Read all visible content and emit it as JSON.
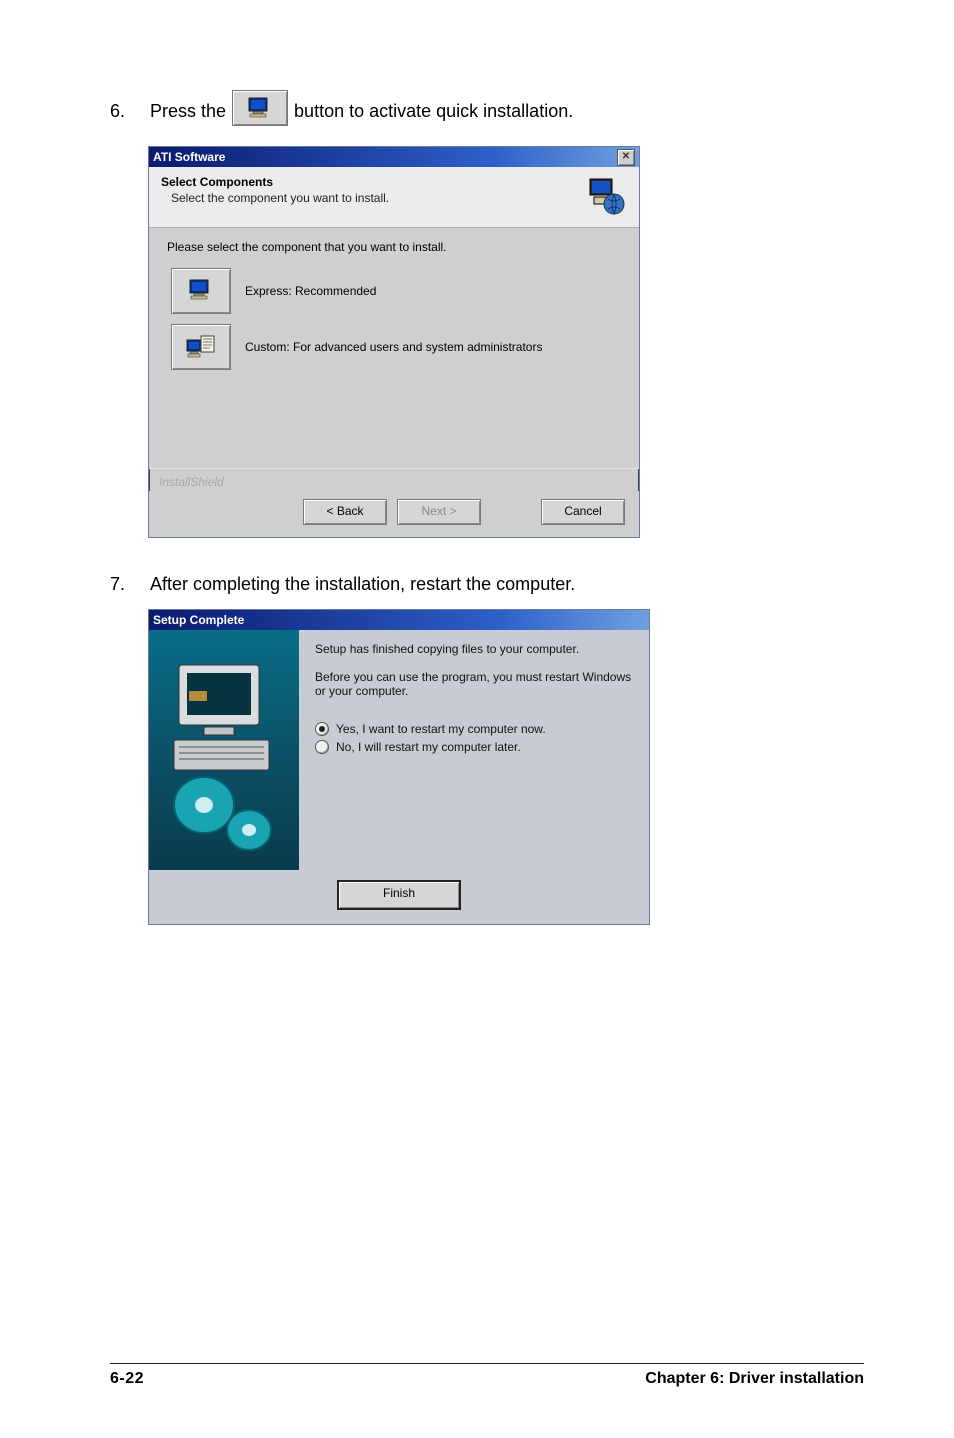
{
  "step6": {
    "num": "6.",
    "before": "Press the",
    "after": "button to activate quick installation."
  },
  "dlg1": {
    "title": "ATI Software",
    "header_title": "Select Components",
    "header_sub": "Select the component you want to install.",
    "body_instr": "Please select the component that you want to install.",
    "express_label": "Express: Recommended",
    "custom_label": "Custom: For advanced users and system administrators",
    "brand": "InstallShield",
    "back": "< Back",
    "next": "Next >",
    "cancel": "Cancel"
  },
  "step7": {
    "num": "7.",
    "text": "After completing the installation, restart the computer."
  },
  "dlg2": {
    "title": "Setup Complete",
    "line1": "Setup has finished copying files to your computer.",
    "line2": "Before you can use the program, you must restart Windows or your computer.",
    "radio_yes": "Yes, I want to restart my computer now.",
    "radio_no": "No, I will restart my computer later.",
    "finish": "Finish"
  },
  "footer": {
    "left": "6-22",
    "right": "Chapter 6: Driver installation"
  }
}
